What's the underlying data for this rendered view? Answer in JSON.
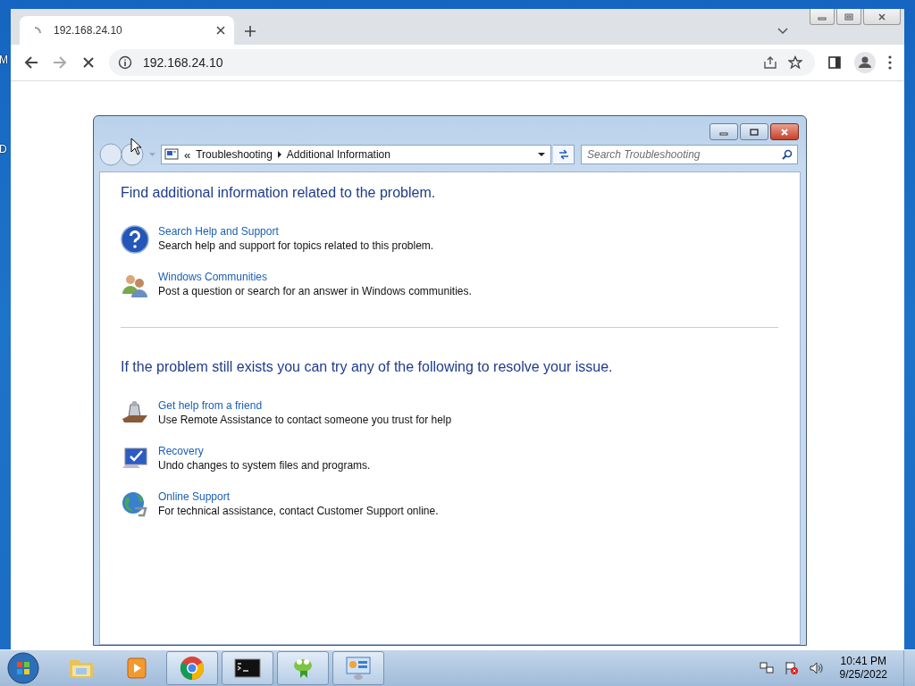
{
  "desktop": {
    "icon_labels": [
      "M",
      "D"
    ]
  },
  "browser": {
    "tab": {
      "title": "192.168.24.10",
      "loading": true
    },
    "address": "192.168.24.10"
  },
  "dialog": {
    "breadcrumb": {
      "prefix": "«",
      "items": [
        "Troubleshooting",
        "Additional Information"
      ]
    },
    "search": {
      "placeholder": "Search Troubleshooting"
    },
    "sections": [
      {
        "heading": "Find additional information related to the problem.",
        "items": [
          {
            "kind": "help",
            "title": "Search Help and Support",
            "description": "Search help and support for topics related to this problem."
          },
          {
            "kind": "people",
            "title": "Windows Communities",
            "description": "Post a question or search for an answer in Windows communities."
          }
        ]
      },
      {
        "heading": "If the problem still exists you can try any of the following to resolve your issue.",
        "items": [
          {
            "kind": "assist",
            "title": "Get help from a friend",
            "description": "Use Remote Assistance to contact someone you trust for help"
          },
          {
            "kind": "recovery",
            "title": "Recovery",
            "description": "Undo changes to system files and programs."
          },
          {
            "kind": "globe",
            "title": "Online Support",
            "description": "For technical assistance, contact Customer Support online."
          }
        ]
      }
    ]
  },
  "taskbar": {
    "apps": [
      {
        "kind": "folder",
        "running": false
      },
      {
        "kind": "media",
        "running": false
      },
      {
        "kind": "browser",
        "running": true
      },
      {
        "kind": "terminal",
        "running": true
      },
      {
        "kind": "lizard",
        "running": true
      },
      {
        "kind": "panel",
        "running": true
      }
    ],
    "clock": {
      "time": "10:41 PM",
      "date": "9/25/2022"
    }
  }
}
